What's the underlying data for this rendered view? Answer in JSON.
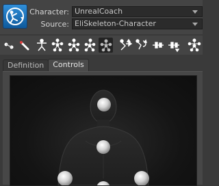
{
  "character_row": {
    "label": "Character:",
    "value": "UnrealCoach"
  },
  "source_row": {
    "label": "Source:",
    "value": "EliSkeleton-Character"
  },
  "toolbar": {
    "icons": [
      "bone-icon",
      "edit-bone-icon",
      "stick-figure-icon",
      "full-body-icon",
      "mirror-body-icon",
      "body-part-icon",
      "skeleton-icon",
      "pin-translate-icon",
      "pin-rotate-icon",
      "reach-translate-icon",
      "reach-rotate-icon",
      "ik-figure-icon"
    ]
  },
  "tabs": [
    {
      "label": "Definition",
      "selected": false
    },
    {
      "label": "Controls",
      "selected": true
    }
  ],
  "colors": {
    "accent": "#1f76c2",
    "viewport_bg": "#141414",
    "control_node": "#e0e0e0"
  }
}
